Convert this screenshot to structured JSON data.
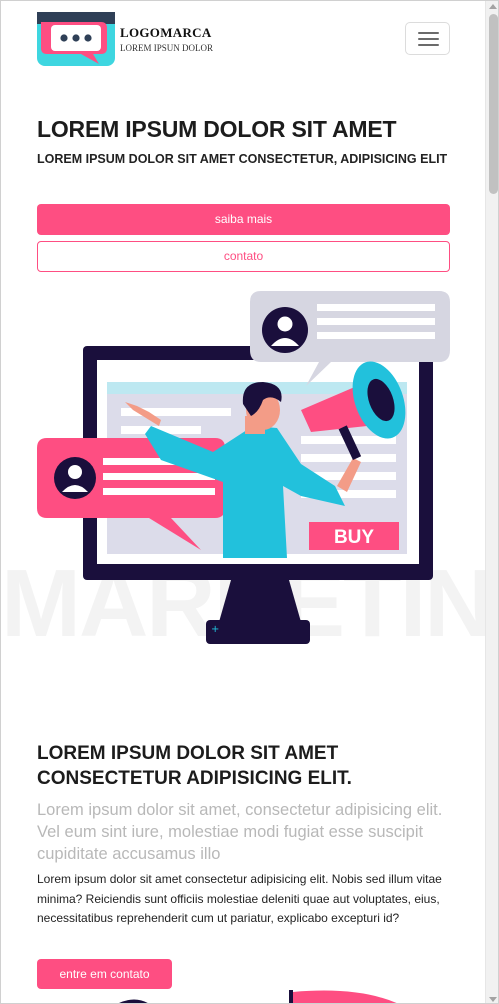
{
  "header": {
    "brand_name": "LOGOMARCA",
    "brand_tagline": "LOREM IPSUN DOLOR",
    "menu_icon": "hamburger-menu-icon",
    "logo_icon": "chat-bubble-logo-icon"
  },
  "hero": {
    "title": "LOREM IPSUM DOLOR SIT AMET",
    "subtitle": "LOREM IPSUM DOLOR SIT AMET CONSECTETUR, ADIPISICING ELIT",
    "primary_button": "saiba mais",
    "secondary_button": "contato",
    "illustration": {
      "buy_label": "BUY",
      "watermark": "MARKETING"
    }
  },
  "section": {
    "title": "LOREM IPSUM DOLOR SIT AMET CONSECTETUR ADIPISICING ELIT.",
    "lead": "Lorem ipsum dolor sit amet, consectetur adipisicing elit. Vel eum sint iure, molestiae modi fugiat esse suscipit cupiditate accusamus illo",
    "body": "Lorem ipsum dolor sit amet consectetur adipisicing elit. Nobis sed illum vitae minima? Reiciendis sunt officiis molestiae deleniti quae aut voluptates, eius, necessitatibus reprehenderit cum ut pariatur, explicabo excepturi id?",
    "button": "entre em contato"
  },
  "colors": {
    "accent": "#fe4e82",
    "dark": "#1a0f3c",
    "cyan": "#22c1dc",
    "logo_dark": "#2f4057"
  }
}
